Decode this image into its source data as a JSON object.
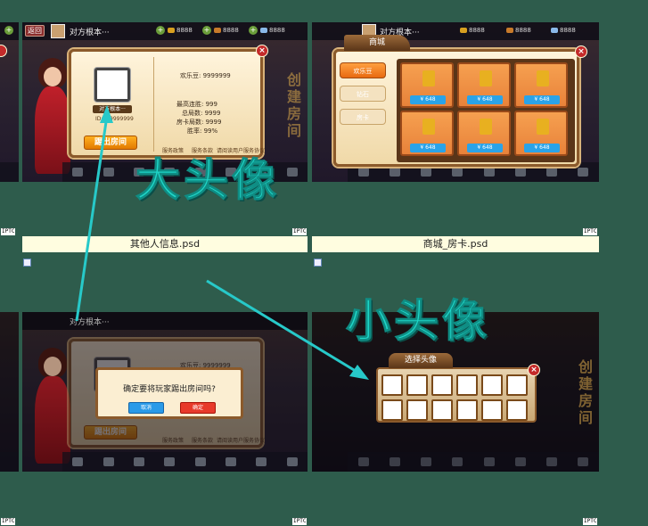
{
  "left_strip": {
    "plus": "+"
  },
  "top_left": {
    "back_label": "返回",
    "nickname": "对方根本···",
    "res1": "8888",
    "res2": "8888",
    "res3": "8888",
    "plus": "+",
    "close": "×",
    "name_bar": "对方根本···",
    "id_text": "ID:999999999",
    "kick_label": "踢出房间",
    "happy_beans": "欢乐豆: 9999999",
    "stats": [
      "最高连胜: 999",
      "总局数: 9999",
      "房卡局数: 9999",
      "胜率: 99%"
    ],
    "footer": [
      "服务政策",
      "服务条款",
      "请阅读用户服务协议"
    ],
    "side_text": "创建房间"
  },
  "top_right": {
    "nickname": "对方根本···",
    "res1": "8888",
    "res2": "8888",
    "res3": "8888",
    "shop_title": "商城",
    "tabs": [
      "欢乐豆",
      "钻石",
      "房卡"
    ],
    "card_label": "房卡",
    "price": "¥ 648",
    "close": "×"
  },
  "labels": {
    "left": "其他人信息.psd",
    "right": "商城_房卡.psd"
  },
  "iptc": "IPTC",
  "annotations": {
    "big": "大头像",
    "small": "小头像"
  },
  "bottom_left": {
    "nickname": "对方根本···",
    "happy_beans": "欢乐豆: 9999999",
    "confirm_text": "确定要将玩家踢出房间吗?",
    "cancel": "取消",
    "ok": "确定",
    "kick_label": "踢出房间",
    "footer": [
      "服务政策",
      "服务条款",
      "请阅读用户服务协议"
    ]
  },
  "bottom_right": {
    "select_title": "选择头像",
    "close": "×",
    "side_text": "创建房间"
  },
  "colors": {
    "background": "#2e5c4c",
    "annotation": "#1fd6c8",
    "arrow": "#27c9c9"
  }
}
